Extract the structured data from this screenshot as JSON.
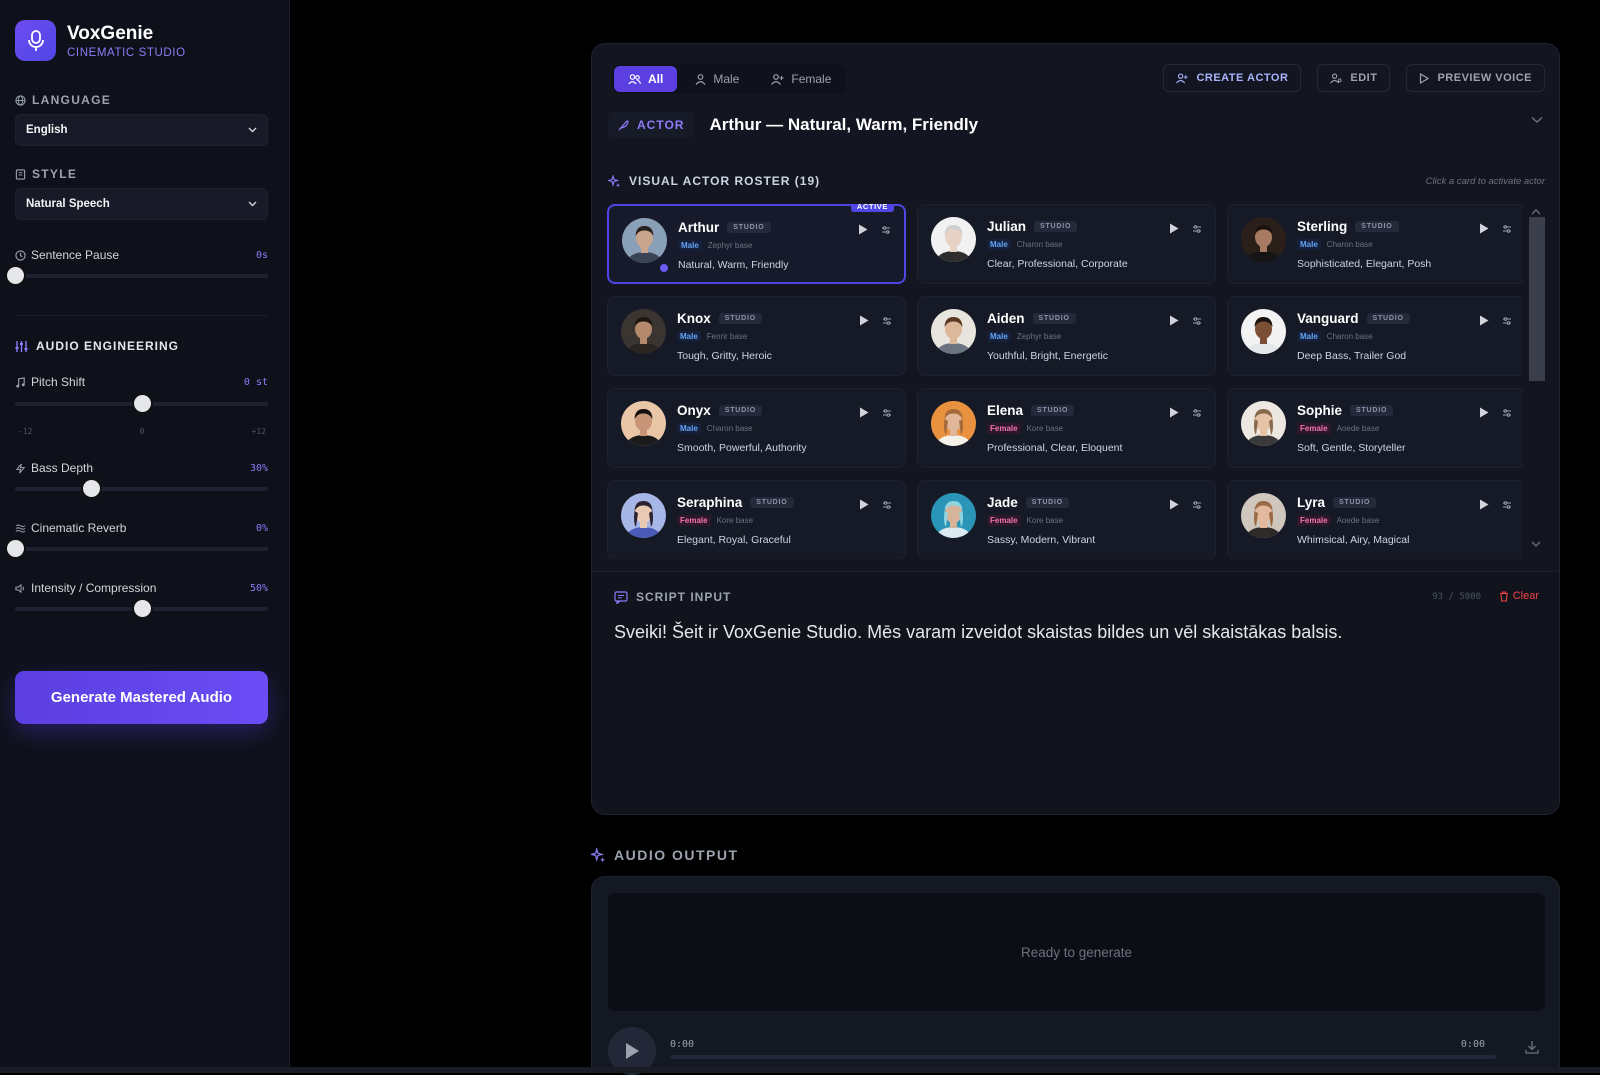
{
  "brand": {
    "name": "VoxGenie",
    "subtitle": "CINEMATIC STUDIO"
  },
  "sidebar": {
    "language_label": "LANGUAGE",
    "language_value": "English",
    "style_label": "STYLE",
    "style_value": "Natural Speech",
    "sentence_pause": {
      "label": "Sentence Pause",
      "value": "0s",
      "level": 0
    },
    "audio_engineering_label": "AUDIO ENGINEERING",
    "pitch_shift": {
      "label": "Pitch Shift",
      "value": "0 st",
      "level": 0.5,
      "ticks": [
        "-12",
        "0",
        "+12"
      ]
    },
    "bass_depth": {
      "label": "Bass Depth",
      "value": "30%",
      "level": 0.3
    },
    "cinematic_reverb": {
      "label": "Cinematic Reverb",
      "value": "0%",
      "level": 0
    },
    "intensity": {
      "label": "Intensity / Compression",
      "value": "50%",
      "level": 0.5
    },
    "generate_label": "Generate Mastered Audio"
  },
  "tabs": [
    {
      "label": "All",
      "active": true
    },
    {
      "label": "Male",
      "active": false
    },
    {
      "label": "Female",
      "active": false
    }
  ],
  "actions": {
    "create": "CREATE ACTOR",
    "edit": "EDIT",
    "preview": "PREVIEW VOICE"
  },
  "actor": {
    "tag": "ACTOR",
    "title": "Arthur — Natural, Warm, Friendly"
  },
  "roster": {
    "label": "VISUAL ACTOR ROSTER (19)",
    "hint": "Click a card to activate actor",
    "active_badge": "ACTIVE",
    "studio_tag": "STUDIO",
    "cards": [
      {
        "name": "Arthur",
        "gender": "Male",
        "base": "Zephyr base",
        "traits": "Natural, Warm, Friendly",
        "active": true,
        "skin": "#c9a58d",
        "hair": "#2b2220",
        "bg": "#8aa0b8",
        "shirt": "#3a4456"
      },
      {
        "name": "Julian",
        "gender": "Male",
        "base": "Charon base",
        "traits": "Clear, Professional, Corporate",
        "active": false,
        "skin": "#e6d3c5",
        "hair": "#cfcfcf",
        "bg": "#f1f1f1",
        "shirt": "#2d2d2d"
      },
      {
        "name": "Sterling",
        "gender": "Male",
        "base": "Charon base",
        "traits": "Sophisticated, Elegant, Posh",
        "active": false,
        "skin": "#a87a62",
        "hair": "#1c1310",
        "bg": "#2b1f1a",
        "shirt": "#151515"
      },
      {
        "name": "Knox",
        "gender": "Male",
        "base": "Fenrir base",
        "traits": "Tough, Gritty, Heroic",
        "active": false,
        "skin": "#b58a6c",
        "hair": "#1e1613",
        "bg": "#3a3530",
        "shirt": "#2a2520"
      },
      {
        "name": "Aiden",
        "gender": "Male",
        "base": "Zephyr base",
        "traits": "Youthful, Bright, Energetic",
        "active": false,
        "skin": "#dcb79a",
        "hair": "#5a3a25",
        "bg": "#e8e4de",
        "shirt": "#6b7280"
      },
      {
        "name": "Vanguard",
        "gender": "Male",
        "base": "Charon base",
        "traits": "Deep Bass, Trailer God",
        "active": false,
        "skin": "#7a4f36",
        "hair": "#1a120d",
        "bg": "#f3f3f3",
        "shirt": "#e5e7eb"
      },
      {
        "name": "Onyx",
        "gender": "Male",
        "base": "Charon base",
        "traits": "Smooth, Powerful, Authority",
        "active": false,
        "skin": "#c89478",
        "hair": "#151010",
        "bg": "#e9c6a7",
        "shirt": "#1a1a1a"
      },
      {
        "name": "Elena",
        "gender": "Female",
        "base": "Kore base",
        "traits": "Professional, Clear, Eloquent",
        "active": false,
        "skin": "#e0b899",
        "hair": "#a56a3a",
        "bg": "#e8913f",
        "shirt": "#f4f1ea"
      },
      {
        "name": "Sophie",
        "gender": "Female",
        "base": "Aoede base",
        "traits": "Soft, Gentle, Storyteller",
        "active": false,
        "skin": "#e6c2a6",
        "hair": "#8a6a4c",
        "bg": "#ece7e0",
        "shirt": "#3a3a3a"
      },
      {
        "name": "Seraphina",
        "gender": "Female",
        "base": "Kore base",
        "traits": "Elegant, Royal, Graceful",
        "active": false,
        "skin": "#e8c9b4",
        "hair": "#2b2430",
        "bg": "#a6b6e6",
        "shirt": "#4a5ab8"
      },
      {
        "name": "Jade",
        "gender": "Female",
        "base": "Kore base",
        "traits": "Sassy, Modern, Vibrant",
        "active": false,
        "skin": "#d7b39a",
        "hair": "#8fd3df",
        "bg": "#2b95b8",
        "shirt": "#dbe9f0"
      },
      {
        "name": "Lyra",
        "gender": "Female",
        "base": "Aoede base",
        "traits": "Whimsical, Airy, Magical",
        "active": false,
        "skin": "#e2b99c",
        "hair": "#9a6a44",
        "bg": "#cfc7bd",
        "shirt": "#2e2a28"
      }
    ]
  },
  "script": {
    "label": "SCRIPT INPUT",
    "counter": "93 / 5000",
    "clear_label": "Clear",
    "text": "Sveiki! Šeit ir VoxGenie Studio. Mēs varam izveidot skaistas bildes un vēl skaistākas balsis."
  },
  "output": {
    "label": "AUDIO OUTPUT",
    "status": "Ready to generate",
    "time_current": "0:00",
    "time_total": "0:00",
    "progress": 0
  },
  "colors": {
    "accent": "#5b3fe0",
    "male": "#60a5fa",
    "female": "#f472b6"
  }
}
